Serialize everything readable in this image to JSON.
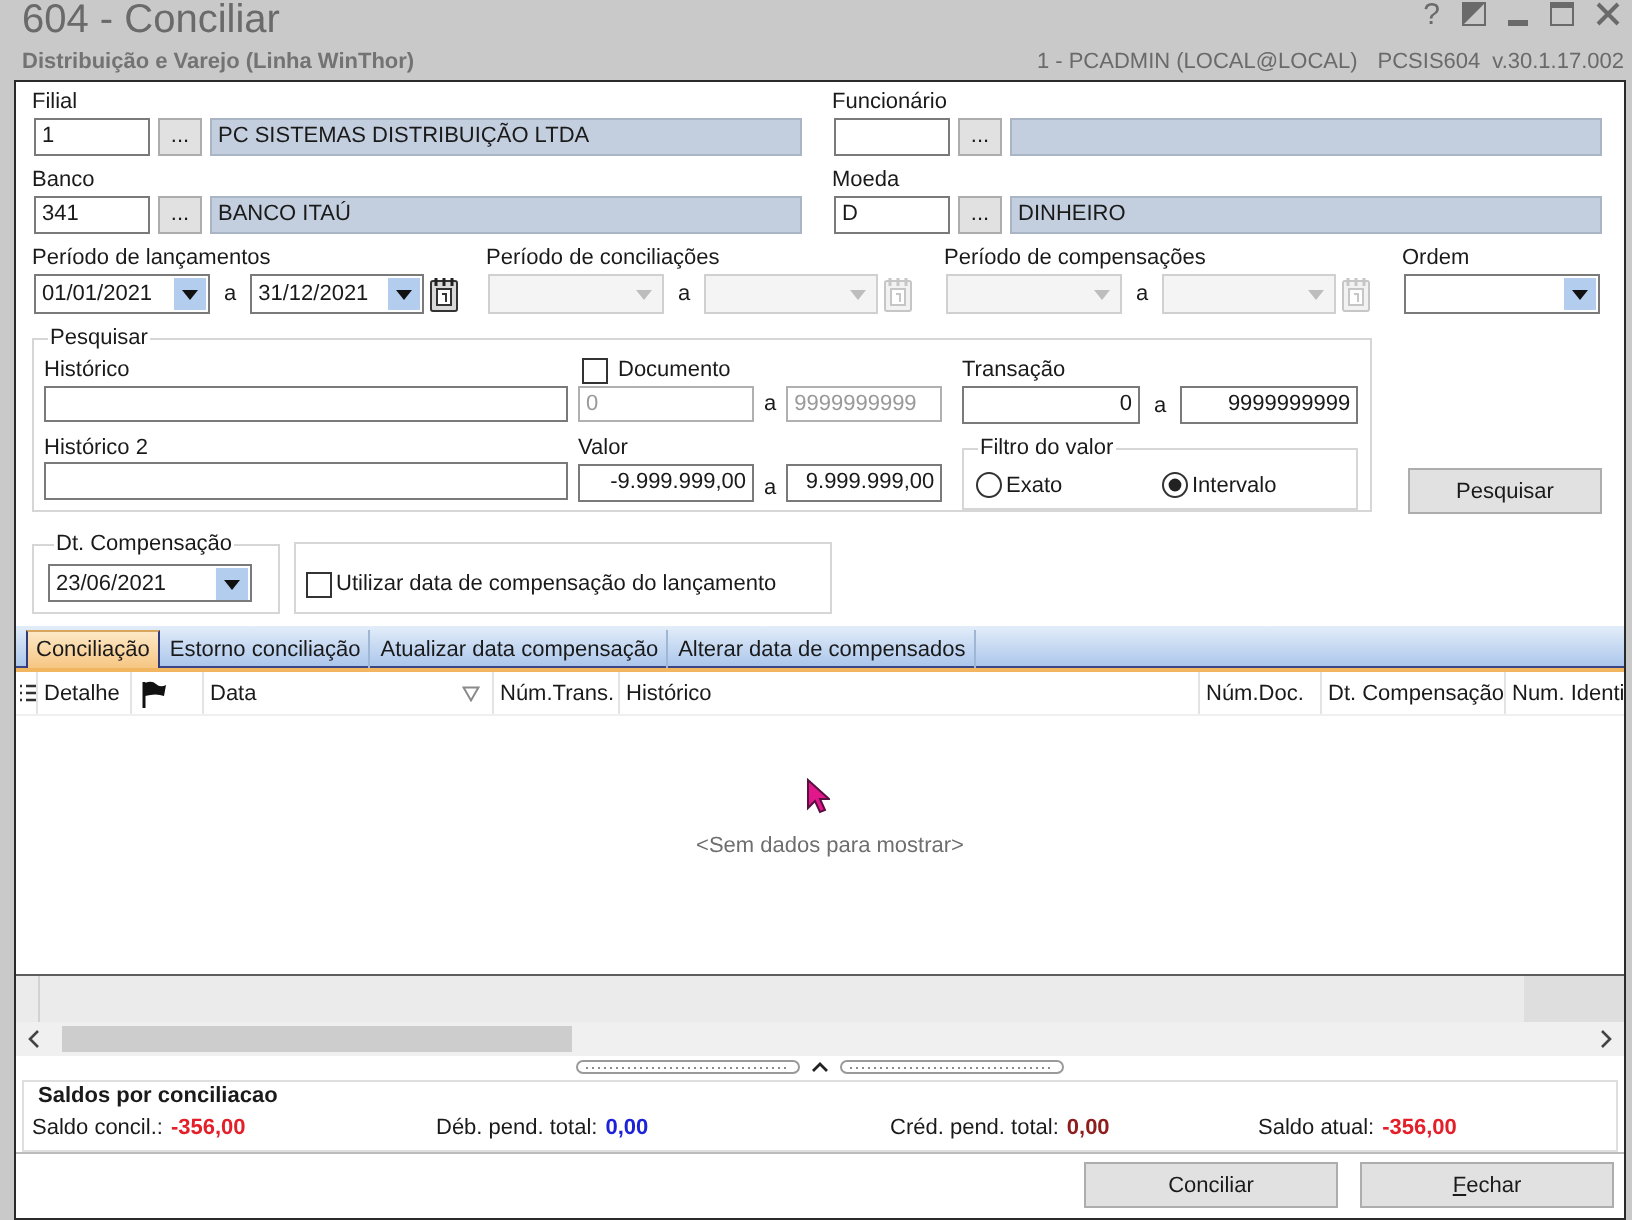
{
  "window": {
    "title": "604 - Conciliar",
    "help": "?",
    "subtitle": "Distribuição e Varejo (Linha WinThor)",
    "user": "1 - PCADMIN (LOCAL@LOCAL)",
    "program": "PCSIS604",
    "version": "v.30.1.17.002"
  },
  "lookups": [
    {
      "label": "Filial",
      "code": "1",
      "button": "...",
      "name": "PC SISTEMAS DISTRIBUIÇÃO LTDA"
    },
    {
      "label": "Funcionário",
      "button": "..."
    },
    {
      "label": "Banco",
      "code": "341",
      "button": "...",
      "name": "BANCO ITAÚ"
    },
    {
      "label": "Moeda",
      "code": "D",
      "button": "...",
      "name": "DINHEIRO"
    }
  ],
  "periods": [
    {
      "label": "Período de lançamentos",
      "from": "01/01/2021",
      "separator": "a",
      "to": "31/12/2021",
      "disabled": false
    },
    {
      "label": "Período de conciliações",
      "separator": "a",
      "disabled": true
    },
    {
      "label": "Período de compensações",
      "separator": "a",
      "disabled": true
    }
  ],
  "order": {
    "label": "Ordem"
  },
  "search": {
    "title": "Pesquisar",
    "historico": {
      "label": "Histórico"
    },
    "documento": {
      "label": "Documento",
      "checked": false,
      "from": "0",
      "separator": "a",
      "to": "9999999999"
    },
    "transacao": {
      "label": "Transação",
      "from": "0",
      "separator": "a",
      "to": "9999999999"
    },
    "historico_2": {
      "label": "Histórico 2"
    },
    "valor": {
      "label": "Valor",
      "from": "-9.999.999,00",
      "separator": "a",
      "to": "9.999.999,00"
    },
    "value_filter": {
      "title": "Filtro do valor",
      "options": [
        {
          "label": "Exato",
          "selected": false
        },
        {
          "label": "Intervalo",
          "selected": true
        }
      ]
    },
    "button": "Pesquisar"
  },
  "compensation": {
    "title": "Dt. Compensação",
    "date": "23/06/2021",
    "use_entry_date": {
      "label": "Utilizar data de compensação do lançamento",
      "checked": false
    }
  },
  "tabs": [
    {
      "label": "Conciliação",
      "selected": true
    },
    {
      "label": "Estorno conciliação",
      "selected": false
    },
    {
      "label": "Atualizar data compensação",
      "selected": false
    },
    {
      "label": "Alterar data de compensados",
      "selected": false
    }
  ],
  "grid": {
    "columns": [
      {
        "kind": "text",
        "label": "Detalhe"
      },
      {
        "kind": "flag"
      },
      {
        "kind": "sortable",
        "label": "Data"
      },
      {
        "kind": "text",
        "label": "Núm.Trans."
      },
      {
        "kind": "text",
        "label": "Histórico"
      },
      {
        "kind": "text",
        "label": "Núm.Doc."
      },
      {
        "kind": "text",
        "label": "Dt. Compensação"
      },
      {
        "kind": "text",
        "label": "Num. Identi"
      }
    ],
    "empty_message": "<Sem dados para mostrar>"
  },
  "balances": {
    "title": "Saldos por conciliacao",
    "items": [
      {
        "label": "Saldo concil.:",
        "value": "-356,00",
        "color": "#e3202a"
      },
      {
        "label": "Déb. pend. total:",
        "value": "0,00",
        "color": "#1c22d8"
      },
      {
        "label": "Créd. pend. total:",
        "value": "0,00",
        "color": "#8e1d1d"
      },
      {
        "label": "Saldo atual:",
        "value": "-356,00",
        "color": "#e3202a"
      }
    ]
  },
  "buttons": [
    {
      "label": "Conciliar",
      "access_key": false
    },
    {
      "label": "Fechar",
      "access_key": true
    }
  ]
}
